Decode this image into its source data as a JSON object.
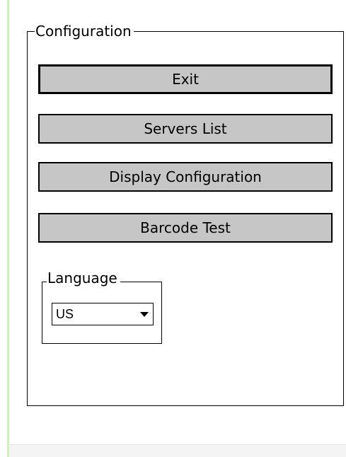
{
  "configuration": {
    "title": "Configuration",
    "buttons": {
      "exit": "Exit",
      "servers_list": "Servers List",
      "display_configuration": "Display Configuration",
      "barcode_test": "Barcode Test"
    },
    "language": {
      "title": "Language",
      "selected": "US",
      "icon": "chevron-down-icon"
    }
  },
  "colors": {
    "button_face": "#c6c6c6",
    "border": "#000000",
    "side_accent": "#d6ebc8"
  }
}
